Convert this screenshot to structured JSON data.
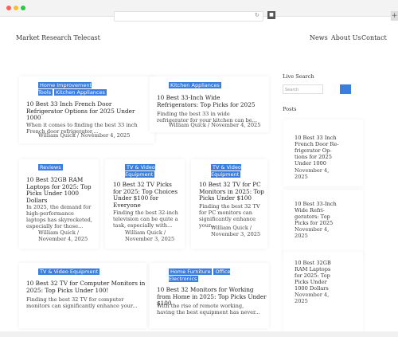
{
  "browser": {
    "reload_glyph": "↻",
    "stop_glyph": "■",
    "new_tab_glyph": "+"
  },
  "header": {
    "site_title": "Market Research Telecast",
    "nav": [
      "News",
      "About Us",
      "Contact"
    ]
  },
  "posts": [
    {
      "tags": [
        "Home Improvement Tools",
        "Kitchen Appliances"
      ],
      "title": "10 Best 33 Inch French Door Refrigerator Options for 2025 Under 1000",
      "excerpt": "When it comes to finding the best 33 inch French door refrigerator,...",
      "author": "William Quick",
      "date": "November 4, 2025"
    },
    {
      "tags": [
        "Kitchen Appliances"
      ],
      "title": "10 Best 33-Inch Wide Refrigerators: Top Picks for 2025",
      "excerpt": "Finding the best 33 in wide refrigerator for your kitchen can be...",
      "author": "William Quick",
      "date": "November 4, 2025"
    },
    {
      "tags": [
        "Reviews"
      ],
      "title": "10 Best 32GB RAM Laptops for 2025: Top Picks Under 1000 Dollars",
      "excerpt": "In 2025, the demand for high-performance laptops has skyrocketed, especially for those...",
      "author": "William Quick",
      "date": "November 4, 2025"
    },
    {
      "tags": [
        "TV & Video Equipment"
      ],
      "title": "10 Best 32 TV Picks for 2025: Top Choices Under $100 for Everyone",
      "excerpt": "Finding the best 32-inch television can be quite a task, especially with...",
      "author": "William Quick",
      "date": "November 3, 2025"
    },
    {
      "tags": [
        "TV & Video Equipment"
      ],
      "title": "10 Best 32 TV for PC Monitors in 2025: Top Picks Under $100",
      "excerpt": "Finding the best 32 TV for PC monitors can significantly enhance your...",
      "author": "William Quick",
      "date": "November 3, 2025"
    },
    {
      "tags": [
        "TV & Video Equipment"
      ],
      "title": "10 Best 32 TV for Computer Monitors in 2025: Top Picks Under 100!",
      "excerpt": "Finding the best 32 TV for computer monitors can significantly enhance your...",
      "author": "",
      "date": ""
    },
    {
      "tags": [
        "Home Furniture",
        "Office Electronics"
      ],
      "title": "10 Best 32 Monitors for Working from Home in 2025: Top Picks Under $100",
      "excerpt": "With the rise of remote working, having the best equipment has never...",
      "author": "",
      "date": ""
    }
  ],
  "sidebar": {
    "search_heading": "Live Search",
    "search_placeholder": "Search",
    "posts_heading": "Posts",
    "posts": [
      {
        "title": "10 Best 33 Inch French Door Re- frigerator Op- tions for 2025 Under 1000",
        "date": "November 4, 2025"
      },
      {
        "title": "10 Best 33-Inch Wide Refri- gerators: Top Picks for 2025",
        "date": "November 4, 2025"
      },
      {
        "title": "10 Best 32GB RAM Laptops for 2025: Top Picks Under 1000 Dollars",
        "date": "November 4, 2025"
      }
    ]
  },
  "colors": {
    "accent": "#3b7ee0",
    "text": "#222222"
  }
}
